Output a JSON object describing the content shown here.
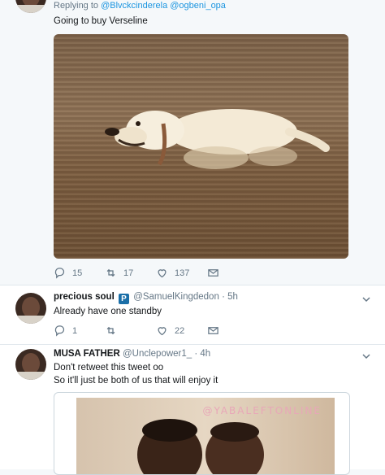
{
  "tweets": [
    {
      "reply_prefix": "Replying to",
      "reply_handles": "@Blvckcinderela @ogbeni_opa",
      "text": "Going to buy Verseline",
      "actions": {
        "replies": "15",
        "retweets": "17",
        "likes": "137"
      }
    },
    {
      "name": "precious soul",
      "badge": "P",
      "handle": "@SamuelKingdedon",
      "time": "· 5h",
      "text": "Already have one standby",
      "actions": {
        "replies": "1",
        "retweets": "",
        "likes": "22"
      }
    },
    {
      "name": "MUSA FATHER",
      "handle": "@Unclepower1_",
      "time": "· 4h",
      "text_lines": [
        "Don't retweet this tweet oo",
        "So it'll just be both of us that will enjoy it"
      ],
      "watermark": "@YABALEFTONLINE"
    }
  ],
  "colors": {
    "link": "#1b95e0",
    "muted": "#657786",
    "background": "#f5f8fa"
  },
  "icons": [
    "reply-icon",
    "retweet-icon",
    "like-icon",
    "message-icon",
    "chevron-down-icon"
  ]
}
